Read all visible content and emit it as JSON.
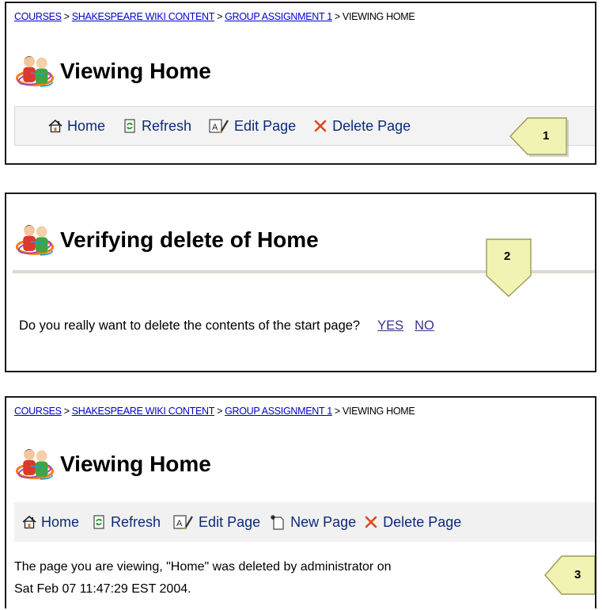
{
  "breadcrumb": {
    "courses": "COURSES",
    "wiki": "SHAKESPEARE WIKI CONTENT",
    "group": "GROUP ASSIGNMENT 1",
    "current": "VIEWING HOME",
    "separator": ">"
  },
  "panel1": {
    "title": "Viewing Home",
    "toolbar": {
      "home": "Home",
      "refresh": "Refresh",
      "edit": "Edit Page",
      "delete": "Delete Page"
    },
    "callout": "1"
  },
  "panel2": {
    "title": "Verifying delete of Home",
    "callout": "2",
    "question": "Do you really want to delete the contents of the start page?",
    "yes": "YES",
    "no": "NO"
  },
  "panel3": {
    "title": "Viewing Home",
    "toolbar": {
      "home": "Home",
      "refresh": "Refresh",
      "edit": "Edit Page",
      "new": "New Page",
      "delete": "Delete Page"
    },
    "message_line1": "The page you are viewing, \"Home\" was deleted by administrator on",
    "message_line2": "Sat Feb 07 11:47:29 EST 2004.",
    "callout": "3"
  },
  "icons": [
    "people-logo-icon",
    "home-icon",
    "refresh-icon",
    "edit-icon",
    "new-page-icon",
    "delete-icon"
  ],
  "colors": {
    "link": "#0000cc",
    "toolbar_bg": "#f3f3f3",
    "callout": "#f0f3b2",
    "delete": "#e0461c"
  }
}
